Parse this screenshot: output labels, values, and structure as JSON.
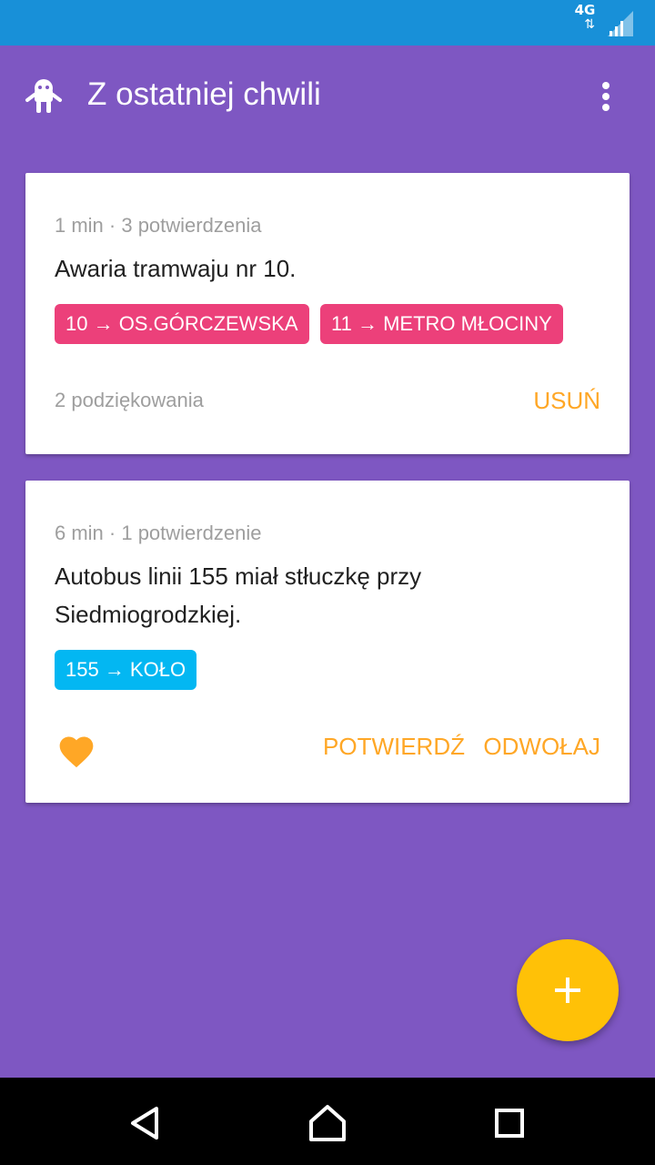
{
  "status_bar": {
    "network_type": "4G",
    "network_arrows": "⇅",
    "background": "#1890d8",
    "icons": [
      "network-activity-icon",
      "signal-strength-icon"
    ]
  },
  "app_bar": {
    "title": "Z ostatniej chwili",
    "logo_icon": "ghost-mascot-icon",
    "menu_icon": "more-vert-icon",
    "background": "#7e57c2"
  },
  "reports": [
    {
      "meta": "1 min · 3 potwierdzenia",
      "message": "Awaria tramwaju nr 10.",
      "tags": [
        {
          "label": "10 → OS.GÓRCZEWSKA",
          "color": "#ec407a"
        },
        {
          "label": "11 → METRO MŁOCINY",
          "color": "#ec407a"
        }
      ],
      "thanks": "2 podziękowania",
      "actions": [
        "USUŃ"
      ]
    },
    {
      "meta": "6 min · 1 potwierdzenie",
      "message": "Autobus linii 155 miał stłuczkę przy Siedmiogrodzkiej.",
      "tags": [
        {
          "label": "155 → KOŁO",
          "color": "#03b7f2"
        }
      ],
      "thank_icon": "heart-icon",
      "actions": [
        "POTWIERDŹ",
        "ODWOŁAJ"
      ]
    }
  ],
  "fab": {
    "icon": "plus-icon",
    "color": "#ffc107"
  },
  "navigation": {
    "icons": [
      "back-icon",
      "home-icon",
      "recents-icon"
    ]
  },
  "colors": {
    "accent": "#ffa726",
    "text_secondary": "#9e9e9e"
  }
}
